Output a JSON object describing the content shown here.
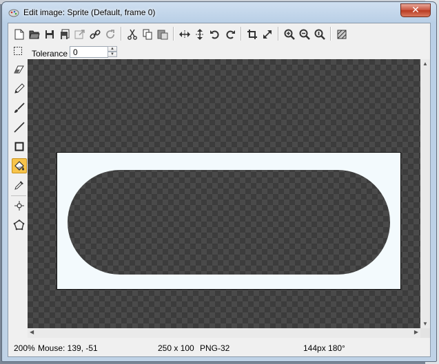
{
  "window": {
    "title": "Edit image: Sprite (Default, frame 0)",
    "close_label": "✕"
  },
  "toolbar": {
    "buttons": [
      "new-icon",
      "open-icon",
      "save-icon",
      "save-as-icon",
      "export-icon",
      "link-icon",
      "reload-icon",
      "cut-icon",
      "copy-icon",
      "paste-icon",
      "flip-horizontal-icon",
      "flip-vertical-icon",
      "rotate-left-icon",
      "rotate-right-icon",
      "crop-icon",
      "resize-icon",
      "zoom-in-icon",
      "zoom-out-icon",
      "zoom-reset-icon",
      "grid-icon"
    ]
  },
  "options": {
    "selection_icon": "dashed-selection-icon",
    "tolerance_label": "Tolerance",
    "tolerance_value": "0"
  },
  "tools": [
    "eraser-icon",
    "pencil-icon",
    "brush-icon",
    "line-icon",
    "rectangle-icon",
    "fill-icon",
    "eyedropper-icon",
    "crosshair-icon",
    "polygon-icon"
  ],
  "active_tool": "fill-icon",
  "colors": {
    "canvas_background": "#3c3c3c",
    "image_background": "#f3fafd",
    "shape_fill": "#3c3c3c",
    "active_tool_highlight": "#f7c44a"
  },
  "status": {
    "zoom": "200%",
    "mouse": "Mouse: 139, -51",
    "dimensions": "250 x 100",
    "format": "PNG-32",
    "brush": "144px 180°"
  }
}
